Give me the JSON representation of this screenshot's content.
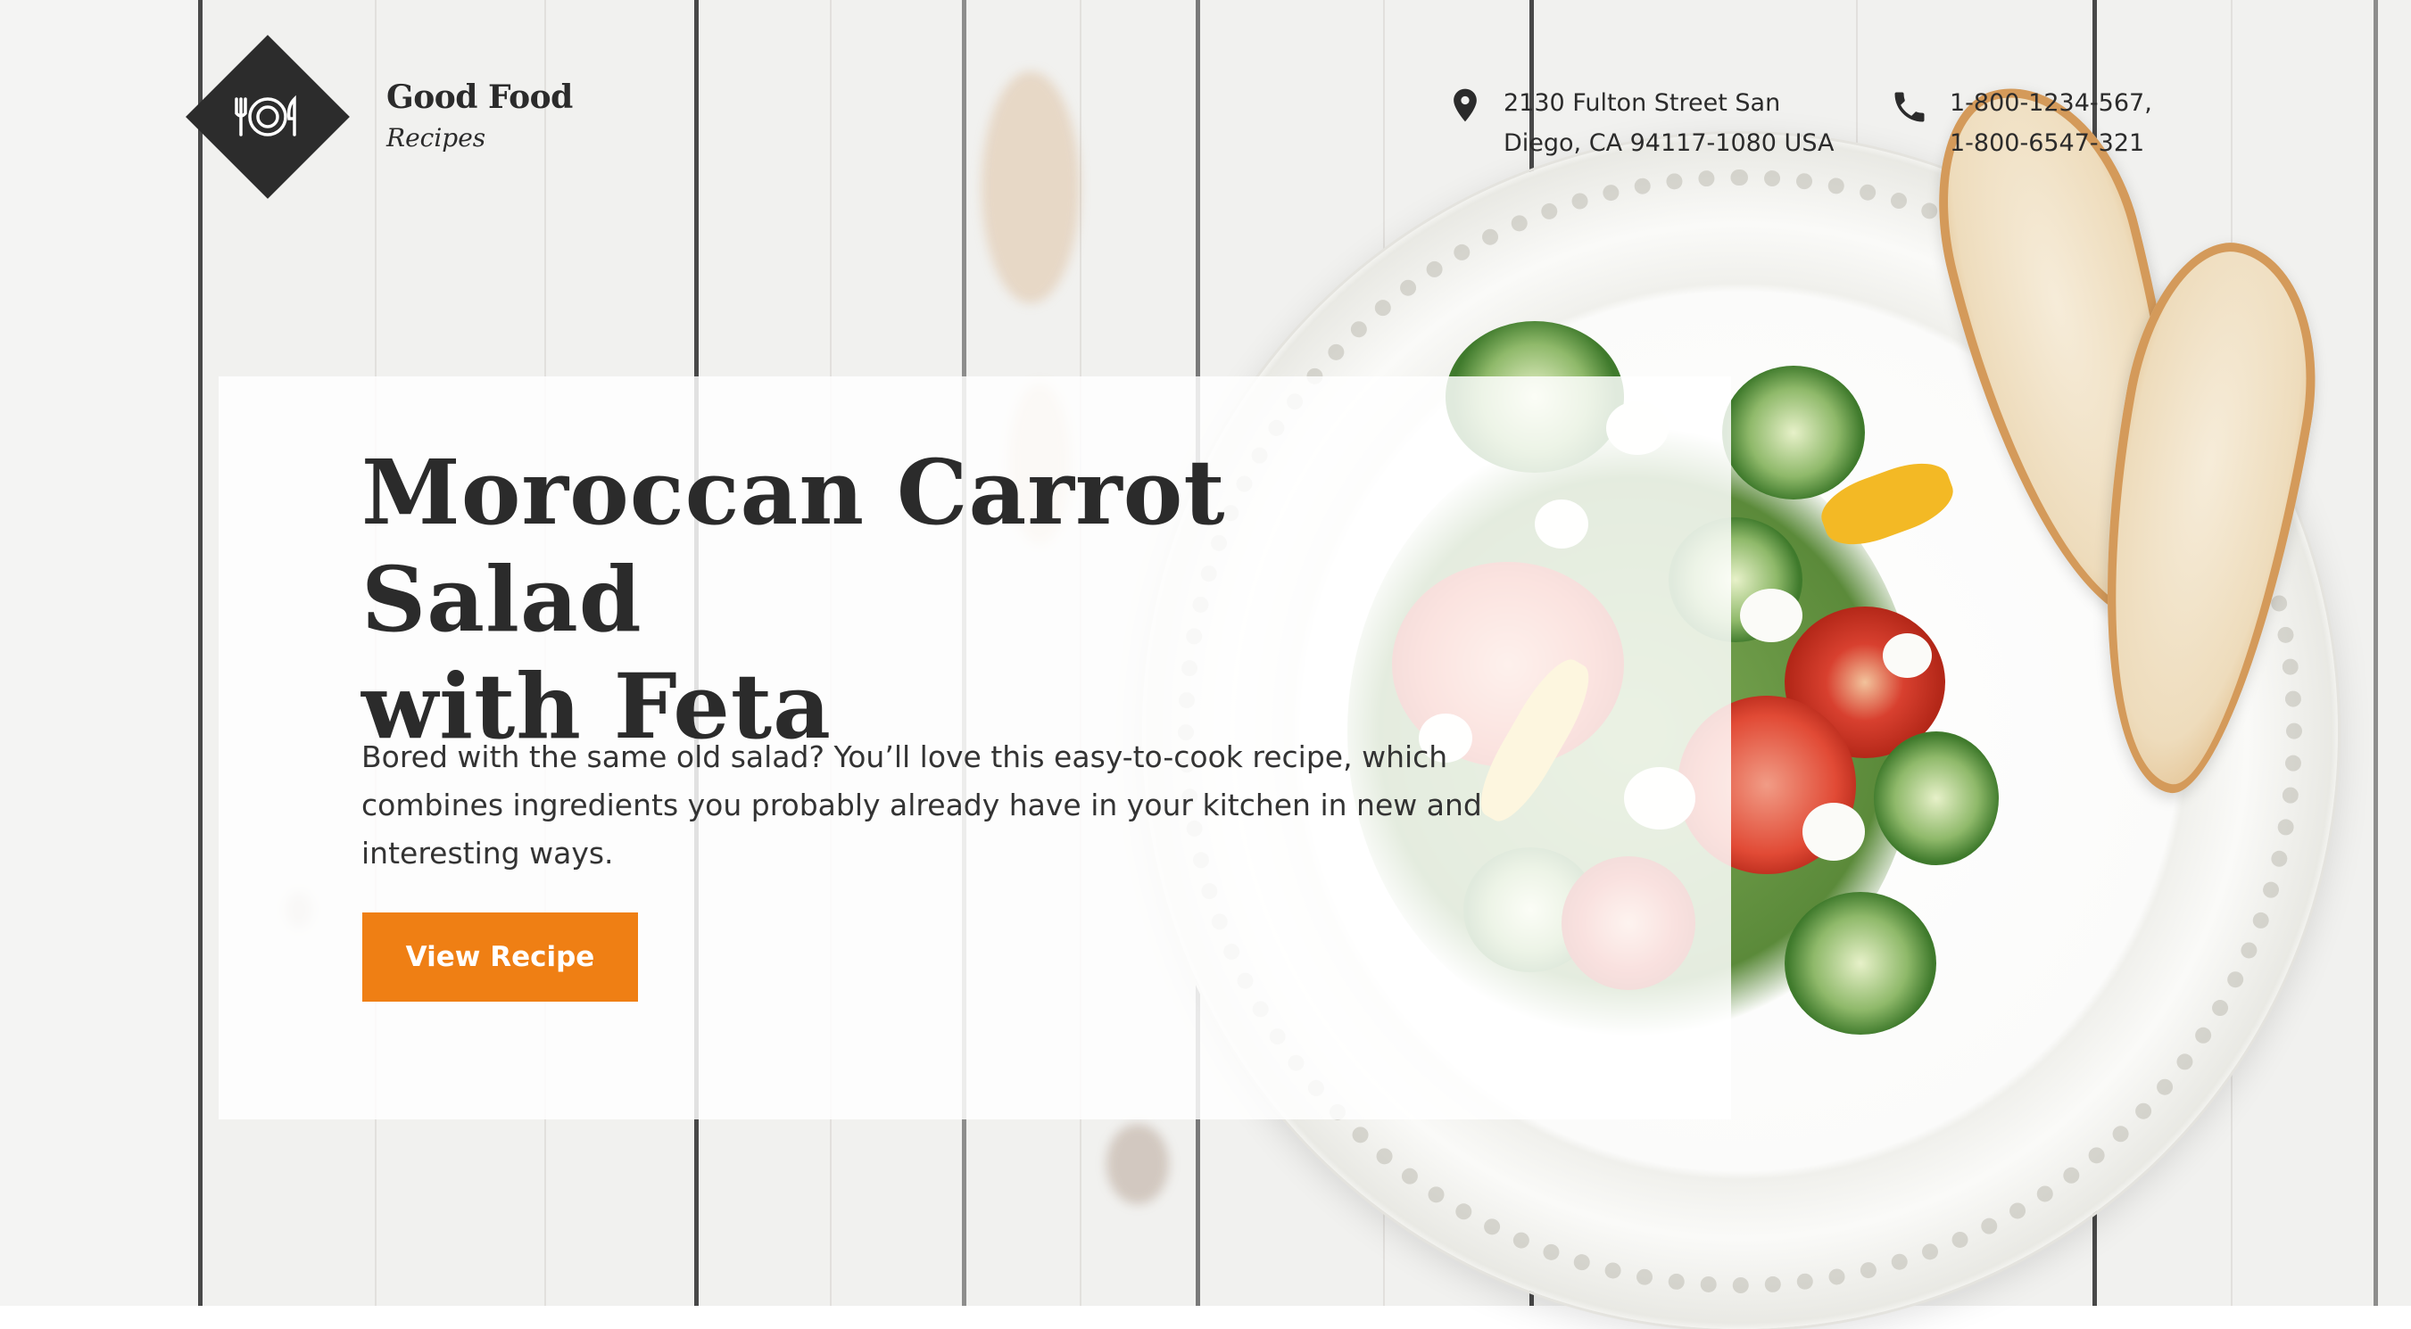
{
  "brand": {
    "name": "Good Food",
    "subtitle": "Recipes"
  },
  "contact": {
    "address_line1": "2130 Fulton Street San",
    "address_line2": "Diego, CA 94117-1080 USA",
    "phone_line1": "1-800-1234-567,",
    "phone_line2": "1-800-6547-321"
  },
  "hero": {
    "title_line1": "Moroccan Carrot Salad",
    "title_line2": "with Feta",
    "description": "Bored with the same old salad? You’ll love this easy-to-cook recipe, which combines ingredients you probably already have in your kitchen in new and interesting ways.",
    "button_label": "View Recipe"
  },
  "colors": {
    "accent": "#ef7f14",
    "text": "#2b2b2b",
    "logo": "#2c2c2c"
  },
  "icons": {
    "logo": "plate-fork-knife-icon",
    "address": "map-pin-icon",
    "phone": "phone-icon"
  }
}
